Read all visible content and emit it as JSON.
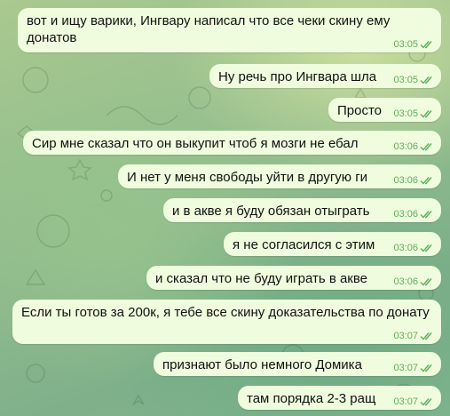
{
  "chat": {
    "messages": [
      {
        "text": "вот и ищу варики, Ингвару написал что все чеки скину ему донатов",
        "time": "03:05"
      },
      {
        "text": "Ну речь про Ингвара шла",
        "time": "03:05"
      },
      {
        "text": "Просто",
        "time": "03:05"
      },
      {
        "text": "Сир мне сказал что он выкупит чтоб я мозги не ебал",
        "time": "03:06"
      },
      {
        "text": "И нет у меня свободы уйти в другую ги",
        "time": "03:06"
      },
      {
        "text": "и в акве я буду обязан отыграть",
        "time": "03:06"
      },
      {
        "text": "я не согласился с этим",
        "time": "03:06"
      },
      {
        "text": "и сказал что не буду играть в акве",
        "time": "03:06"
      },
      {
        "text": "Если ты готов за 200к, я тебе все скину доказательства по донату",
        "time": "03:07"
      },
      {
        "text": "признают было немного Домика",
        "time": "03:07"
      },
      {
        "text": "там порядка 2-3 ращ",
        "time": "03:07"
      }
    ]
  },
  "icons": {
    "read_status": "double-check-icon"
  },
  "colors": {
    "bubble": "#effdde",
    "time": "#5fae5a",
    "text": "#111111"
  }
}
